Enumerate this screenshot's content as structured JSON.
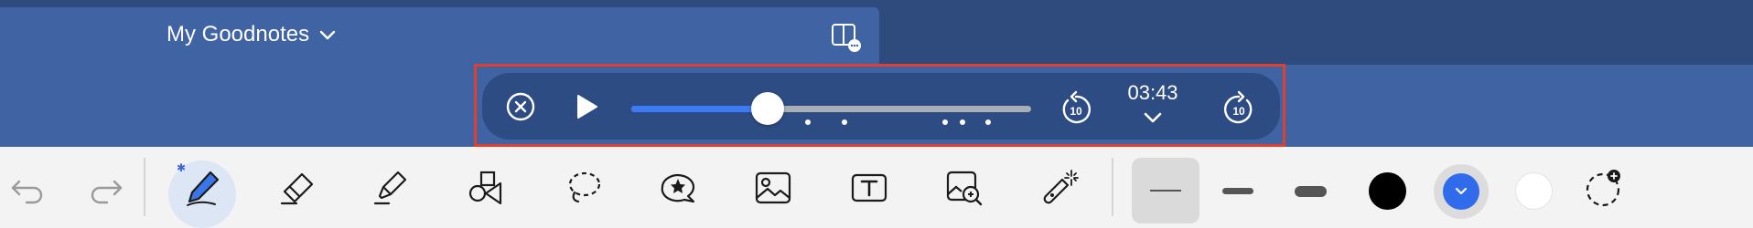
{
  "header": {
    "doc_title": "My Goodnotes"
  },
  "player": {
    "time": "03:43",
    "progress_fraction": 0.34
  },
  "toolbar": {
    "tools": [
      "undo",
      "redo",
      "pen",
      "eraser",
      "highlighter",
      "shapes",
      "lasso",
      "elements",
      "image",
      "text",
      "zoom-window",
      "laser-pointer"
    ],
    "pen_indicator": "✱",
    "stroke_widths": [
      "thin",
      "medium",
      "thick"
    ],
    "colors": {
      "black": "#000000",
      "blue": "#2f6bea",
      "white": "#ffffff"
    }
  }
}
